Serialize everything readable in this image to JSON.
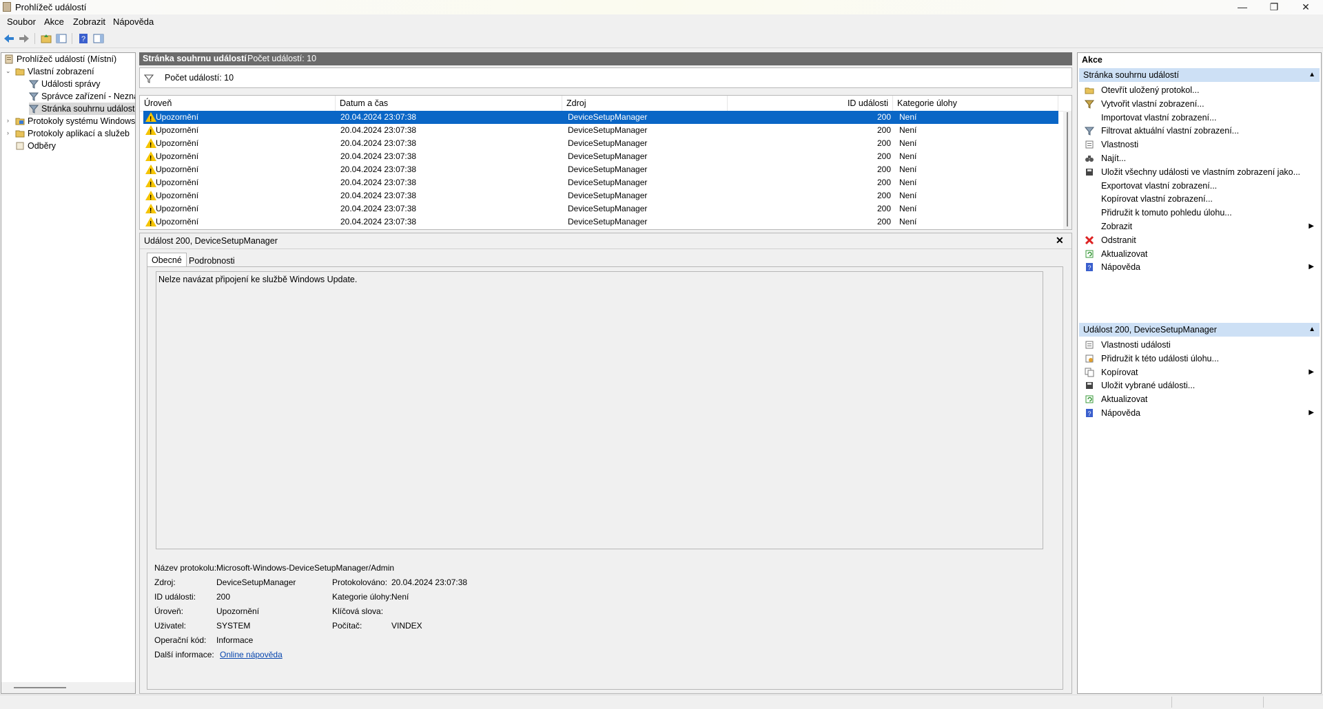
{
  "window": {
    "title": "Prohlížeč událostí"
  },
  "menu": [
    "Soubor",
    "Akce",
    "Zobrazit",
    "Nápověda"
  ],
  "tree": {
    "root": "Prohlížeč událostí (Místní)",
    "custom_views": "Vlastní zobrazení",
    "admin_events": "Události správy",
    "device_manager": "Správce zařízení - Neznámé",
    "summary_page": "Stránka souhrnu událostí",
    "windows_logs": "Protokoly systému Windows",
    "app_logs": "Protokoly aplikací a služeb",
    "subscriptions": "Odběry"
  },
  "center": {
    "header_title": "Stránka souhrnu událostí",
    "header_count": "Počet událostí: 10",
    "filter_text": "Počet událostí: 10",
    "columns": [
      "Úroveň",
      "Datum a čas",
      "Zdroj",
      "ID události",
      "Kategorie úlohy"
    ],
    "rows": [
      {
        "level": "Upozornění",
        "date": "20.04.2024 23:07:38",
        "source": "DeviceSetupManager",
        "id": "200",
        "category": "Není"
      },
      {
        "level": "Upozornění",
        "date": "20.04.2024 23:07:38",
        "source": "DeviceSetupManager",
        "id": "200",
        "category": "Není"
      },
      {
        "level": "Upozornění",
        "date": "20.04.2024 23:07:38",
        "source": "DeviceSetupManager",
        "id": "200",
        "category": "Není"
      },
      {
        "level": "Upozornění",
        "date": "20.04.2024 23:07:38",
        "source": "DeviceSetupManager",
        "id": "200",
        "category": "Není"
      },
      {
        "level": "Upozornění",
        "date": "20.04.2024 23:07:38",
        "source": "DeviceSetupManager",
        "id": "200",
        "category": "Není"
      },
      {
        "level": "Upozornění",
        "date": "20.04.2024 23:07:38",
        "source": "DeviceSetupManager",
        "id": "200",
        "category": "Není"
      },
      {
        "level": "Upozornění",
        "date": "20.04.2024 23:07:38",
        "source": "DeviceSetupManager",
        "id": "200",
        "category": "Není"
      },
      {
        "level": "Upozornění",
        "date": "20.04.2024 23:07:38",
        "source": "DeviceSetupManager",
        "id": "200",
        "category": "Není"
      },
      {
        "level": "Upozornění",
        "date": "20.04.2024 23:07:38",
        "source": "DeviceSetupManager",
        "id": "200",
        "category": "Není"
      }
    ]
  },
  "detail": {
    "title": "Událost 200, DeviceSetupManager",
    "tabs": [
      "Obecné",
      "Podrobnosti"
    ],
    "message": "Nelze navázat připojení ke službě Windows Update.",
    "labels": {
      "log_name": "Název protokolu:",
      "source": "Zdroj:",
      "event_id": "ID události:",
      "level": "Úroveň:",
      "user": "Uživatel:",
      "opcode": "Operační kód:",
      "more_info": "Další informace:",
      "logged": "Protokolováno:",
      "task_category": "Kategorie úlohy:",
      "keywords": "Klíčová slova:",
      "computer": "Počítač:"
    },
    "values": {
      "log_name": "Microsoft-Windows-DeviceSetupManager/Admin",
      "source": "DeviceSetupManager",
      "event_id": "200",
      "level": "Upozornění",
      "user": "SYSTEM",
      "opcode": "Informace",
      "more_info_link": "Online nápověda",
      "logged": "20.04.2024 23:07:38",
      "task_category": "Není",
      "keywords": "",
      "computer": "VINDEX"
    }
  },
  "actions": {
    "pane_title": "Akce",
    "section1": "Stránka souhrnu událostí",
    "items1": [
      {
        "label": "Otevřít uložený protokol...",
        "icon": "folder-open-icon",
        "sub": false
      },
      {
        "label": "Vytvořit vlastní zobrazení...",
        "icon": "filter-create-icon",
        "sub": false
      },
      {
        "label": "Importovat vlastní zobrazení...",
        "icon": "",
        "sub": false
      },
      {
        "label": "Filtrovat aktuální vlastní zobrazení...",
        "icon": "filter-icon",
        "sub": false
      },
      {
        "label": "Vlastnosti",
        "icon": "properties-icon",
        "sub": false
      },
      {
        "label": "Najít...",
        "icon": "binoculars-icon",
        "sub": false
      },
      {
        "label": "Uložit všechny události ve vlastním zobrazení jako...",
        "icon": "save-icon",
        "sub": false
      },
      {
        "label": "Exportovat vlastní zobrazení...",
        "icon": "",
        "sub": false
      },
      {
        "label": "Kopírovat vlastní zobrazení...",
        "icon": "",
        "sub": false
      },
      {
        "label": "Přidružit k tomuto pohledu úlohu...",
        "icon": "",
        "sub": false
      },
      {
        "label": "Zobrazit",
        "icon": "",
        "sub": true
      },
      {
        "label": "Odstranit",
        "icon": "delete-icon",
        "sub": false
      },
      {
        "label": "Aktualizovat",
        "icon": "refresh-icon",
        "sub": false
      },
      {
        "label": "Nápověda",
        "icon": "help-icon",
        "sub": true
      }
    ],
    "section2": "Událost 200, DeviceSetupManager",
    "items2": [
      {
        "label": "Vlastnosti události",
        "icon": "properties-icon",
        "sub": false
      },
      {
        "label": "Přidružit k této události úlohu...",
        "icon": "task-icon",
        "sub": false
      },
      {
        "label": "Kopírovat",
        "icon": "copy-icon",
        "sub": true
      },
      {
        "label": "Uložit vybrané události...",
        "icon": "save-icon",
        "sub": false
      },
      {
        "label": "Aktualizovat",
        "icon": "refresh-icon",
        "sub": false
      },
      {
        "label": "Nápověda",
        "icon": "help-icon",
        "sub": true
      }
    ]
  },
  "colors": {
    "selection": "#0a66c6",
    "section": "#cde0f5",
    "header": "#6b6b6b",
    "warning": "#f5c400"
  }
}
